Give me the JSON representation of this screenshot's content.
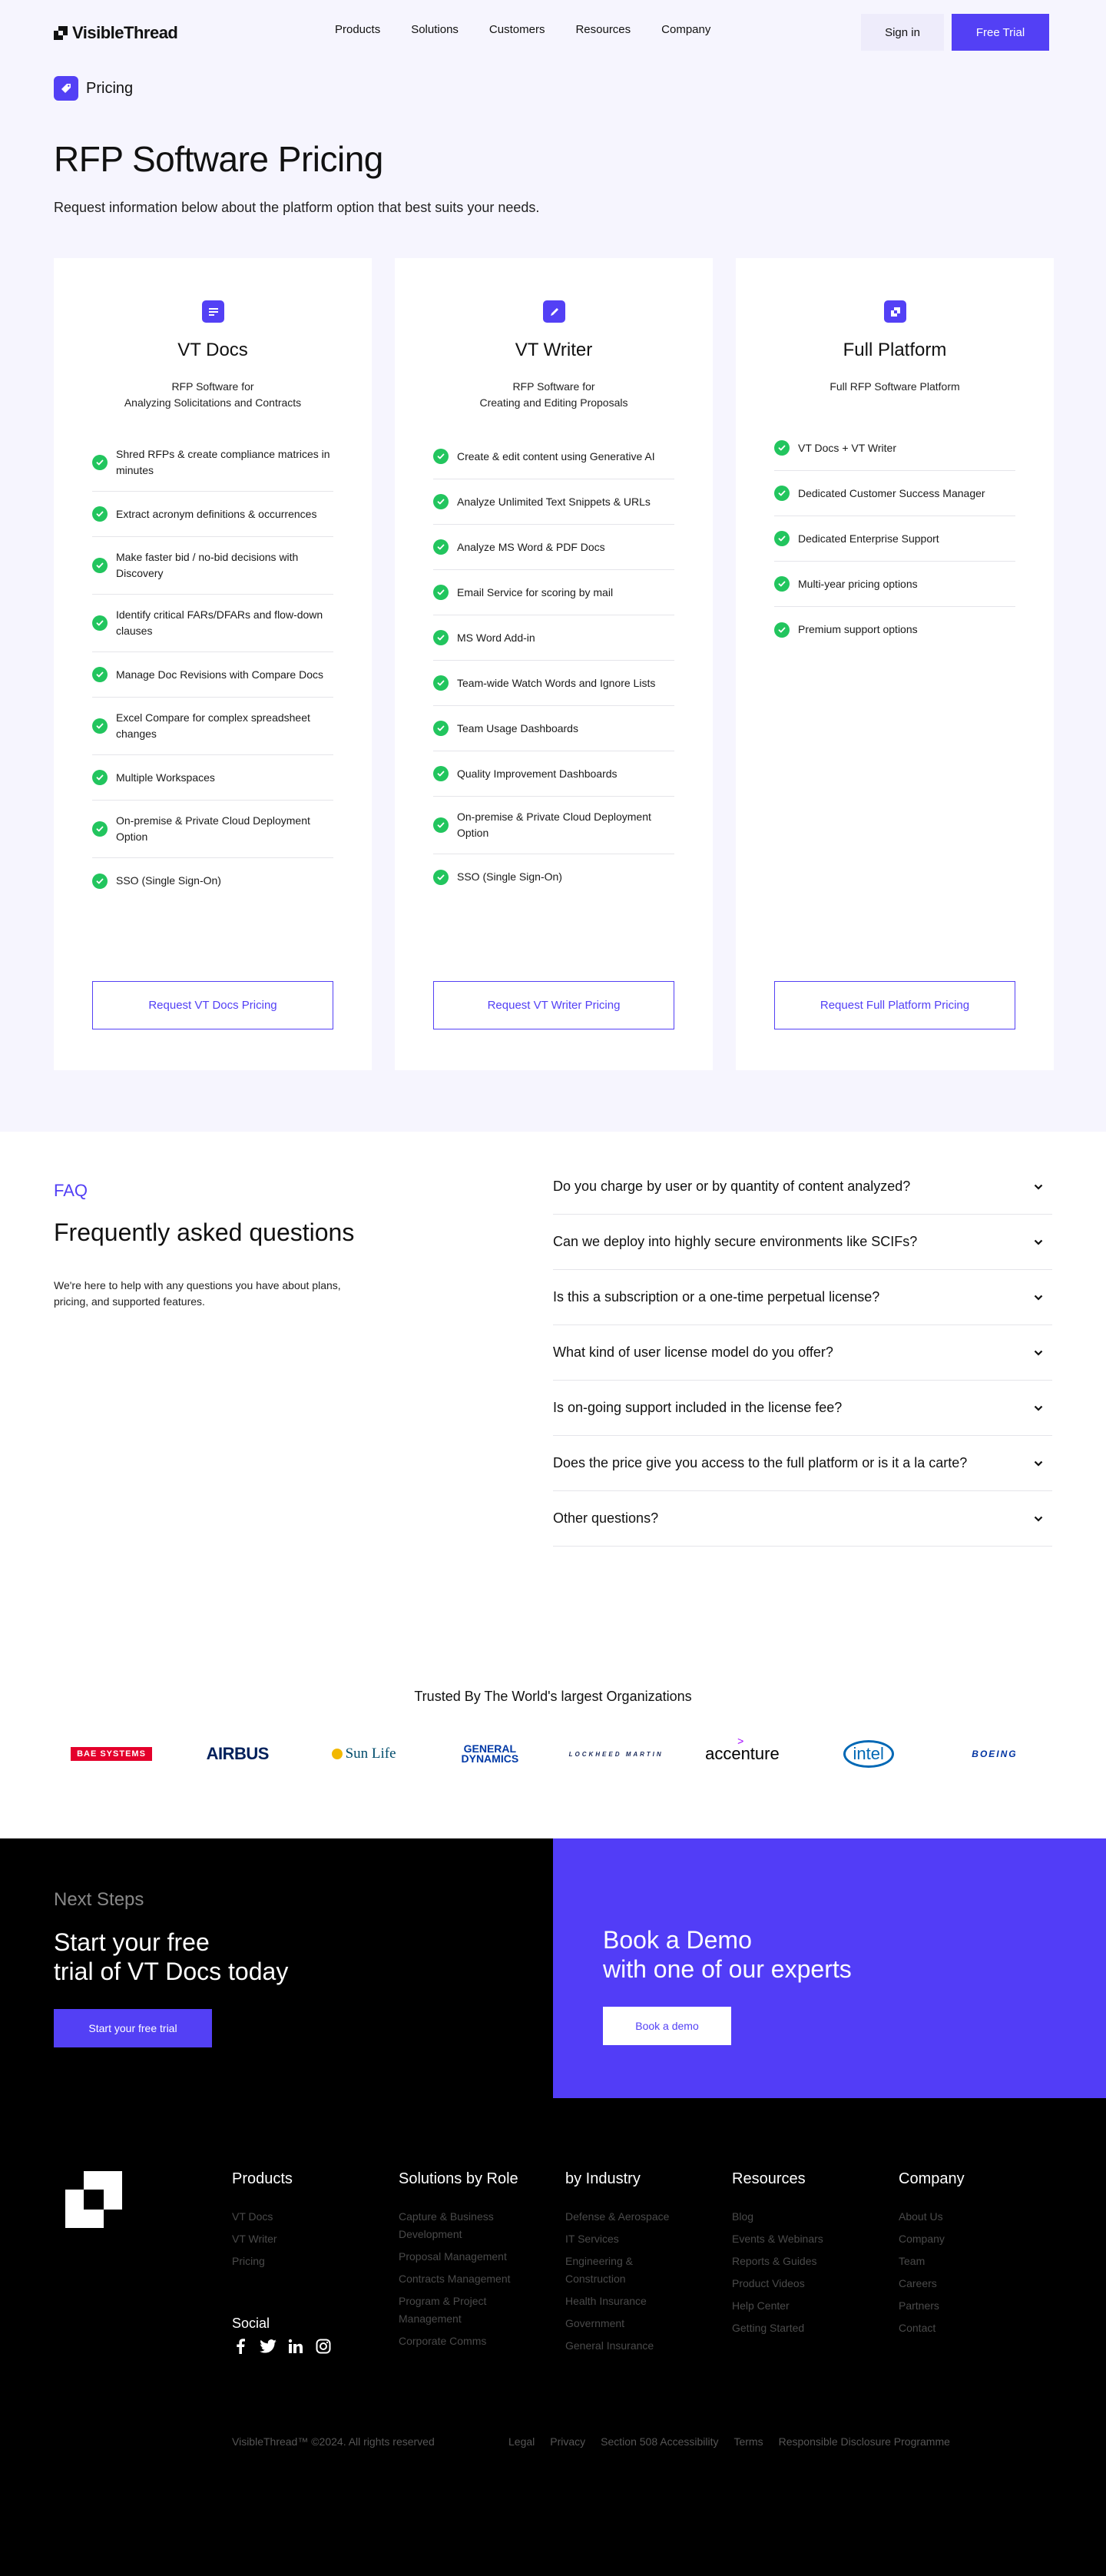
{
  "nav": {
    "brand": "VisibleThread",
    "links": [
      "Products",
      "Solutions",
      "Customers",
      "Resources",
      "Company"
    ],
    "sign_in": "Sign in",
    "free_trial": "Free Trial"
  },
  "breadcrumb": {
    "label": "Pricing",
    "icon": "price-tag-icon"
  },
  "hero": {
    "title": "RFP Software Pricing",
    "subtitle": "Request information below about the platform option that best suits your needs."
  },
  "accent_color": "#5340f5",
  "check_color": "#22c55e",
  "cards": [
    {
      "icon": "document-lines-icon",
      "title": "VT Docs",
      "subtitle": "RFP Software for\nAnalyzing Solicitations and Contracts",
      "features": [
        "Shred RFPs & create compliance matrices in minutes",
        "Extract acronym definitions & occurrences",
        "Make faster bid / no-bid decisions with Discovery",
        "Identify critical FARs/DFARs and flow-down clauses",
        "Manage Doc Revisions with Compare Docs",
        "Excel Compare for complex spreadsheet changes",
        "Multiple Workspaces",
        "On-premise & Private Cloud Deployment Option",
        "SSO (Single Sign-On)"
      ],
      "button": "Request VT Docs Pricing"
    },
    {
      "icon": "pencil-icon",
      "title": "VT Writer",
      "subtitle": "RFP Software for\nCreating and Editing Proposals",
      "features": [
        "Create & edit content using Generative AI",
        "Analyze Unlimited Text Snippets & URLs",
        "Analyze MS Word & PDF Docs",
        "Email Service for scoring by mail",
        "MS Word Add-in",
        "Team-wide Watch Words and Ignore Lists",
        "Team Usage Dashboards",
        "Quality Improvement Dashboards",
        "On-premise & Private Cloud Deployment Option",
        "SSO (Single Sign-On)"
      ],
      "button": "Request VT Writer Pricing"
    },
    {
      "icon": "platform-squares-icon",
      "title": "Full Platform",
      "subtitle": "Full RFP Software Platform",
      "features": [
        "VT Docs + VT Writer",
        "Dedicated Customer Success Manager",
        "Dedicated Enterprise Support",
        "Multi-year pricing options",
        "Premium support options"
      ],
      "button": "Request Full Platform Pricing"
    }
  ],
  "faq": {
    "eyebrow": "FAQ",
    "title": "Frequently asked questions",
    "description": "We're here to help with any questions you have about plans, pricing, and supported features.",
    "questions": [
      "Do you charge by user or by quantity of content analyzed?",
      "Can we deploy into highly secure environments like SCIFs?",
      "Is this a subscription or a one-time perpetual license?",
      "What kind of user license model do you offer?",
      "Is on-going support included in the license fee?",
      "Does the price give you access to the full platform or is it a la carte?",
      "Other questions?"
    ]
  },
  "trusted": {
    "title": "Trusted By The World's largest Organizations",
    "logos": {
      "bae": "BAE SYSTEMS",
      "airbus": "AIRBUS",
      "sunlife": "Sun Life",
      "gd_line1": "GENERAL",
      "gd_line2": "DYNAMICS",
      "lockheed": "LOCKHEED MARTIN",
      "accenture": "accenture",
      "accenture_mark": ">",
      "intel": "intel",
      "boeing": "BOEING"
    }
  },
  "cta": {
    "eyebrow": "Next Steps",
    "title_line1": "Start your free",
    "title_line2": "trial of VT Docs today",
    "start_button": "Start your free trial",
    "demo_line1": "Book a Demo",
    "demo_line2": "with one of our experts",
    "demo_button": "Book a demo"
  },
  "footer": {
    "columns": [
      {
        "title": "Products",
        "links": [
          "VT Docs",
          "VT Writer",
          "Pricing"
        ]
      },
      {
        "title": "Solutions by Role",
        "links": [
          "Capture & Business Development",
          "Proposal Management",
          "Contracts Management",
          "Program & Project Management",
          "Corporate Comms"
        ]
      },
      {
        "title": "by Industry",
        "links": [
          "Defense & Aerospace",
          "IT Services",
          "Engineering & Construction",
          "Health Insurance",
          "Government",
          "General Insurance"
        ]
      },
      {
        "title": "Resources",
        "links": [
          "Blog",
          "Events & Webinars",
          "Reports & Guides",
          "Product Videos",
          "Help Center",
          "Getting Started"
        ]
      },
      {
        "title": "Company",
        "links": [
          "About Us",
          "Company",
          "Team",
          "Careers",
          "Partners",
          "Contact"
        ]
      }
    ],
    "social_title": "Social",
    "social": [
      "facebook-icon",
      "twitter-icon",
      "linkedin-icon",
      "instagram-icon"
    ],
    "copyright": "VisibleThread™ ©2024. All rights reserved",
    "legal": [
      "Legal",
      "Privacy",
      "Section 508 Accessibility",
      "Terms",
      "Responsible Disclosure Programme"
    ]
  }
}
